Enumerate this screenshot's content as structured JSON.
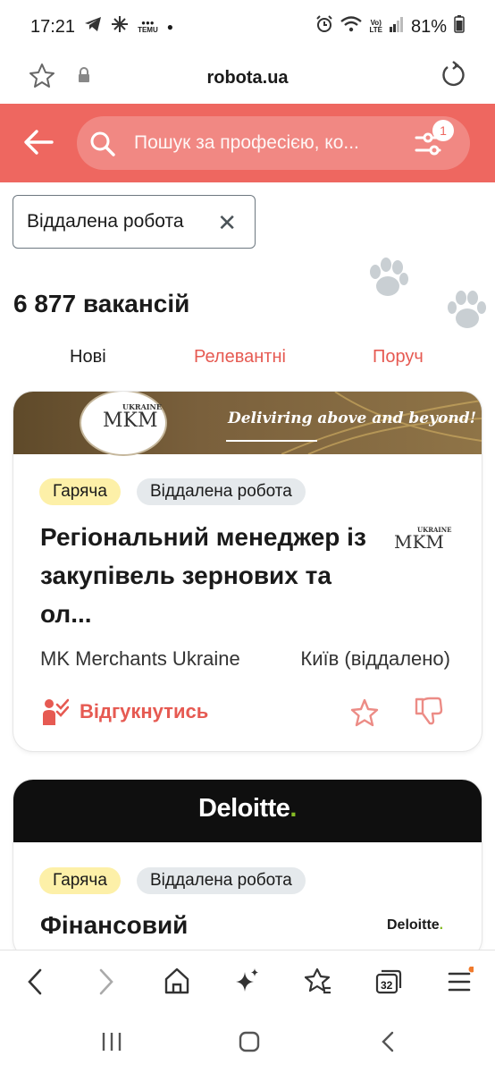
{
  "status": {
    "time": "17:21",
    "battery": "81%",
    "temu": "TEMU",
    "net": "LTE",
    "volte": "Vo)"
  },
  "browser": {
    "url": "robota.ua",
    "tab_count": "32"
  },
  "search": {
    "placeholder": "Пошук за професією, ко...",
    "filter_count": "1"
  },
  "filter_chip": {
    "label": "Віддалена робота"
  },
  "results": {
    "count": "6 877 вакансій"
  },
  "sort_tabs": [
    {
      "label": "Нові",
      "color": "#1a1a1a"
    },
    {
      "label": "Релевантні",
      "color": "#e65a52"
    },
    {
      "label": "Поруч",
      "color": "#e65a52"
    }
  ],
  "jobs": [
    {
      "banner_text": "Deliviring above and beyond!",
      "logo_text": "MKM",
      "logo_small": "UKRAINE",
      "tags": [
        "Гаряча",
        "Віддалена робота"
      ],
      "title": "Регіональний менеджер із закупівель зернових та ол...",
      "company": "MK Merchants Ukraine",
      "city": "Київ (віддалено)",
      "apply_label": "Відгукнутись"
    },
    {
      "banner_text": "Deloitte",
      "logo_text": "Deloitte",
      "tags": [
        "Гаряча",
        "Віддалена робота"
      ],
      "title": "Фінансовий"
    }
  ],
  "colors": {
    "brand": "#ee6760",
    "accent": "#e65a52",
    "hot_tag": "#fdf0a8",
    "remote_tag": "#e5e9ec"
  }
}
